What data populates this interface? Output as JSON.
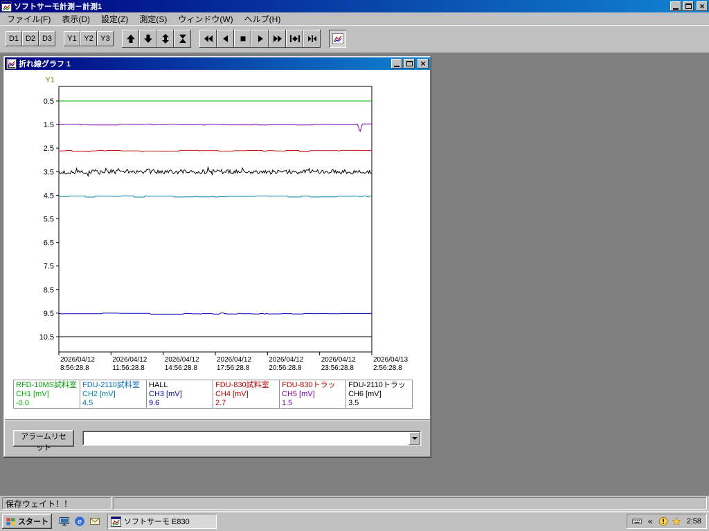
{
  "window": {
    "title": "ソフトサーモ計測－計測1"
  },
  "menu": {
    "items": [
      {
        "label": "ファイル(F)",
        "name": "file"
      },
      {
        "label": "表示(D)",
        "name": "view"
      },
      {
        "label": "設定(Z)",
        "name": "settings"
      },
      {
        "label": "測定(S)",
        "name": "measure"
      },
      {
        "label": "ウィンドウ(W)",
        "name": "window"
      },
      {
        "label": "ヘルプ(H)",
        "name": "help"
      }
    ]
  },
  "toolbar": {
    "groups": [
      {
        "small": true,
        "buttons": [
          {
            "label": "D1",
            "name": "d1-button"
          },
          {
            "label": "D2",
            "name": "d2-button"
          },
          {
            "label": "D3",
            "name": "d3-button"
          }
        ]
      },
      {
        "small": true,
        "buttons": [
          {
            "label": "Y1",
            "name": "y1-button"
          },
          {
            "label": "Y2",
            "name": "y2-button"
          },
          {
            "label": "Y3",
            "name": "y3-button"
          }
        ]
      },
      {
        "buttons": [
          {
            "icon": "arrow-up-icon",
            "name": "scroll-up-button"
          },
          {
            "icon": "arrow-down-icon",
            "name": "scroll-down-button"
          },
          {
            "icon": "arrow-up-down-icon",
            "name": "fit-vertical-button"
          },
          {
            "icon": "hourglass-icon",
            "name": "hourglass-button"
          }
        ]
      },
      {
        "buttons": [
          {
            "icon": "fast-backward-icon",
            "name": "fast-backward-button"
          },
          {
            "icon": "step-backward-icon",
            "name": "step-backward-button"
          },
          {
            "icon": "stop-icon",
            "name": "stop-button"
          },
          {
            "icon": "step-forward-icon",
            "name": "step-forward-button"
          },
          {
            "icon": "fast-forward-icon",
            "name": "fast-forward-button"
          },
          {
            "icon": "ends-outward-icon",
            "name": "expand-range-button"
          },
          {
            "icon": "ends-inward-icon",
            "name": "collapse-range-button"
          }
        ]
      },
      {
        "buttons": [
          {
            "icon": "graph-icon",
            "name": "graph-button",
            "pressed": true
          }
        ]
      }
    ]
  },
  "graph_window": {
    "title": "折れ線グラフ 1",
    "alarm_reset_label": "アラームリセット",
    "combo_value": ""
  },
  "chart_data": {
    "type": "line",
    "axis_label": "Y1",
    "axis_label_color": "#808000",
    "y_axis": {
      "inverted": true,
      "top_value": -0.116,
      "bottom_value": 10.5
    },
    "y_ticks": [
      0.5,
      1.5,
      2.5,
      3.5,
      4.5,
      5.5,
      6.5,
      7.5,
      8.5,
      9.5,
      10.5
    ],
    "x_ticks": [
      {
        "date": "2026/04/12",
        "time": "8:56:28.8"
      },
      {
        "date": "2026/04/12",
        "time": "11:56:28.8"
      },
      {
        "date": "2026/04/12",
        "time": "14:56:28.8"
      },
      {
        "date": "2026/04/12",
        "time": "17:56:28.8"
      },
      {
        "date": "2026/04/12",
        "time": "20:56:28.8"
      },
      {
        "date": "2026/04/12",
        "time": "23:56:28.8"
      },
      {
        "date": "2026/04/13",
        "time": "2:56:28.8"
      }
    ],
    "series": [
      {
        "channel": "CH1",
        "channel_label": "CH1 [mV]",
        "device": "RFD-10MS試料室",
        "value": "-0.0",
        "level": 0.5,
        "noise": 0,
        "color": "#00b400",
        "device_color": "#00a000"
      },
      {
        "channel": "CH2",
        "channel_label": "CH2 [mV]",
        "device": "FDU-2110試料室",
        "value": "4.5",
        "level": 4.55,
        "noise": 0.028,
        "color": "#0080a8",
        "device_color": "#0070c0"
      },
      {
        "channel": "CH3",
        "channel_label": "CH3 [mV]",
        "device": "HALL",
        "value": "9.6",
        "level": 9.52,
        "noise": 0.025,
        "color": "#0000b4",
        "device_color": "#000000"
      },
      {
        "channel": "CH4",
        "channel_label": "CH4 [mV]",
        "device": "FDU-830試料室",
        "value": "2.7",
        "level": 2.62,
        "noise": 0.028,
        "color": "#c00000",
        "device_color": "#c00000"
      },
      {
        "channel": "CH5",
        "channel_label": "CH5 [mV]",
        "device": "FDU-830トラッ",
        "value": "1.5",
        "level": 1.5,
        "noise": 0.025,
        "color": "#7700b4",
        "device_color": "#c00000",
        "spike": {
          "pos": 0.962,
          "delta": 0.38
        }
      },
      {
        "channel": "CH6",
        "channel_label": "CH6 [mV]",
        "device": "FDU-2110トラッ",
        "value": "3.5",
        "level": 3.5,
        "noise": 0.09,
        "burst": 0.13,
        "dense": true,
        "color": "#000000",
        "device_color": "#000000"
      }
    ]
  },
  "status": {
    "text": "保存ウェイト！！"
  },
  "taskbar": {
    "start_label": "スタート",
    "quick_launch": [
      {
        "name": "desktop-icon"
      },
      {
        "name": "ie-icon"
      },
      {
        "name": "mail-icon"
      }
    ],
    "task_button": {
      "label": "ソフトサーモ  E830"
    },
    "tray": {
      "icons": [
        "keyboard-icon",
        "chevrons-left-icon",
        "warning-icon",
        "star-icon"
      ],
      "time": "2:58"
    }
  }
}
